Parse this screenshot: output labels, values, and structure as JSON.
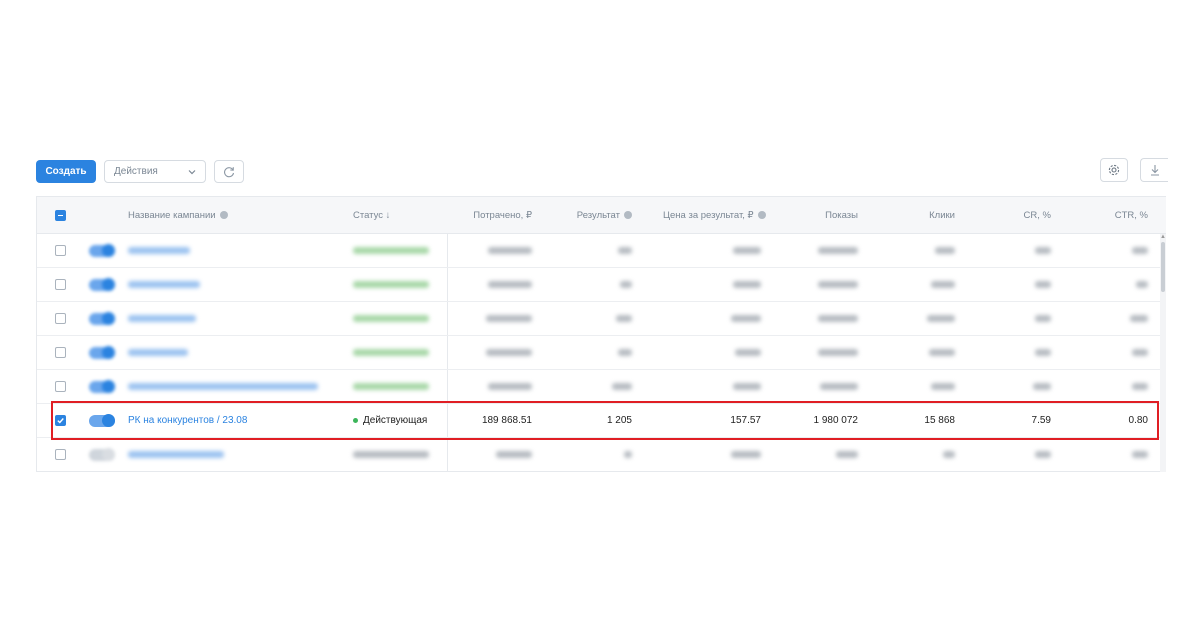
{
  "toolbar": {
    "create_label": "Создать",
    "actions_label": "Действия"
  },
  "table": {
    "headers": {
      "name": "Название кампании",
      "status": "Статус ↓",
      "spent": "Потрачено, ₽",
      "result": "Результат",
      "cost_per_result": "Цена за результат, ₽",
      "impressions": "Показы",
      "clicks": "Клики",
      "cr": "CR, %",
      "ctr": "CTR, %"
    },
    "selected_row": {
      "name": "РК на конкурентов / 23.08",
      "status": "Действующая",
      "spent": "189 868.51",
      "result": "1 205",
      "cost_per_result": "157.57",
      "impressions": "1 980 072",
      "clicks": "15 868",
      "cr": "7.59",
      "ctr": "0.80"
    }
  },
  "colors": {
    "accent": "#2b83e0",
    "highlight": "#e01e24",
    "status_active": "#3cb55a"
  }
}
